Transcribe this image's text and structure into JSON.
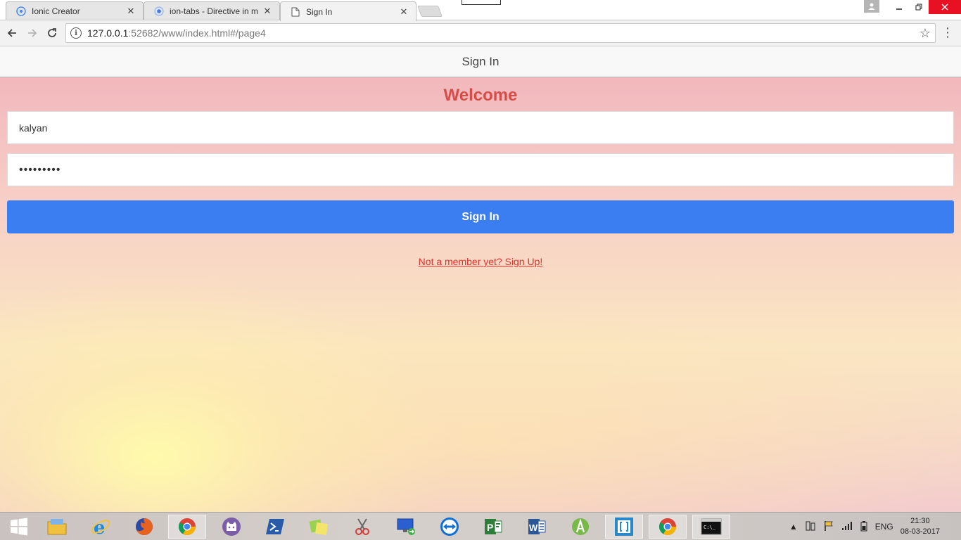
{
  "browser": {
    "tabs": [
      {
        "title": "Ionic Creator",
        "icon": "ionic-icon",
        "active": false
      },
      {
        "title": "ion-tabs - Directive in m",
        "icon": "chromium-icon",
        "active": false
      },
      {
        "title": "Sign In",
        "icon": "document-icon",
        "active": true
      }
    ],
    "close_glyph": "✕",
    "url_host": "127.0.0.1",
    "url_rest": ":52682/www/index.html#/page4"
  },
  "app": {
    "header_title": "Sign In",
    "welcome": "Welcome",
    "username_value": "kalyan",
    "password_value": "•••••••••",
    "signin_label": "Sign In",
    "signup_link": "Not a member yet? Sign Up!"
  },
  "taskbar": {
    "apps": [
      {
        "name": "start-button",
        "color": "#ffffff"
      },
      {
        "name": "file-explorer-icon",
        "color": "#f0c040"
      },
      {
        "name": "internet-explorer-icon",
        "color": "#1f8be0"
      },
      {
        "name": "firefox-icon",
        "color": "#e8621e"
      },
      {
        "name": "chrome-icon",
        "color": "#4caf50"
      },
      {
        "name": "github-icon",
        "color": "#7b5ea7"
      },
      {
        "name": "powershell-icon",
        "color": "#2a5ba8"
      },
      {
        "name": "sticky-notes-icon",
        "color": "#9bd150"
      },
      {
        "name": "snipping-tool-icon",
        "color": "#d03a3a"
      },
      {
        "name": "remote-desktop-icon",
        "color": "#2b5fcf"
      },
      {
        "name": "teamviewer-icon",
        "color": "#0e6fd6"
      },
      {
        "name": "project-icon",
        "color": "#2f7d3a"
      },
      {
        "name": "word-icon",
        "color": "#2b5797"
      },
      {
        "name": "android-studio-icon",
        "color": "#78b94a"
      },
      {
        "name": "brackets-icon",
        "color": "#2a88c9"
      },
      {
        "name": "chrome-icon-2",
        "color": "#4caf50"
      },
      {
        "name": "command-prompt-icon",
        "color": "#111111"
      }
    ],
    "language": "ENG",
    "time": "21:30",
    "date": "08-03-2017"
  }
}
